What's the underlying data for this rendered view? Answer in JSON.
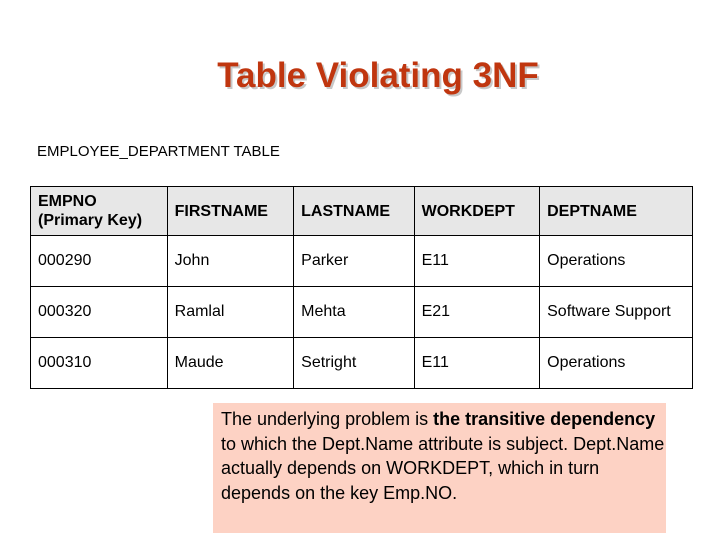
{
  "title": "Table Violating 3NF",
  "table_caption": "EMPLOYEE_DEPARTMENT TABLE",
  "table": {
    "headers": [
      {
        "line1": "EMPNO",
        "line2": "(Primary Key)"
      },
      {
        "line1": "FIRSTNAME"
      },
      {
        "line1": "LASTNAME"
      },
      {
        "line1": "WORKDEPT"
      },
      {
        "line1": "DEPTNAME"
      }
    ],
    "rows": [
      [
        "000290",
        "John",
        "Parker",
        "E11",
        "Operations"
      ],
      [
        "000320",
        "Ramlal",
        "Mehta",
        "E21",
        "Software Support"
      ],
      [
        "000310",
        "Maude",
        "Setright",
        "E11",
        "Operations"
      ]
    ]
  },
  "note": {
    "part1": "The underlying problem is ",
    "bold": "the transitive dependency",
    "part2": " to which the Dept.Name attribute is subject. Dept.Name actually depends on WORKDEPT, which in turn depends on the key Emp.NO."
  },
  "colors": {
    "title": "#c0360f",
    "header_bg": "#e7e7e7",
    "note_bg": "#fdd2c4"
  }
}
